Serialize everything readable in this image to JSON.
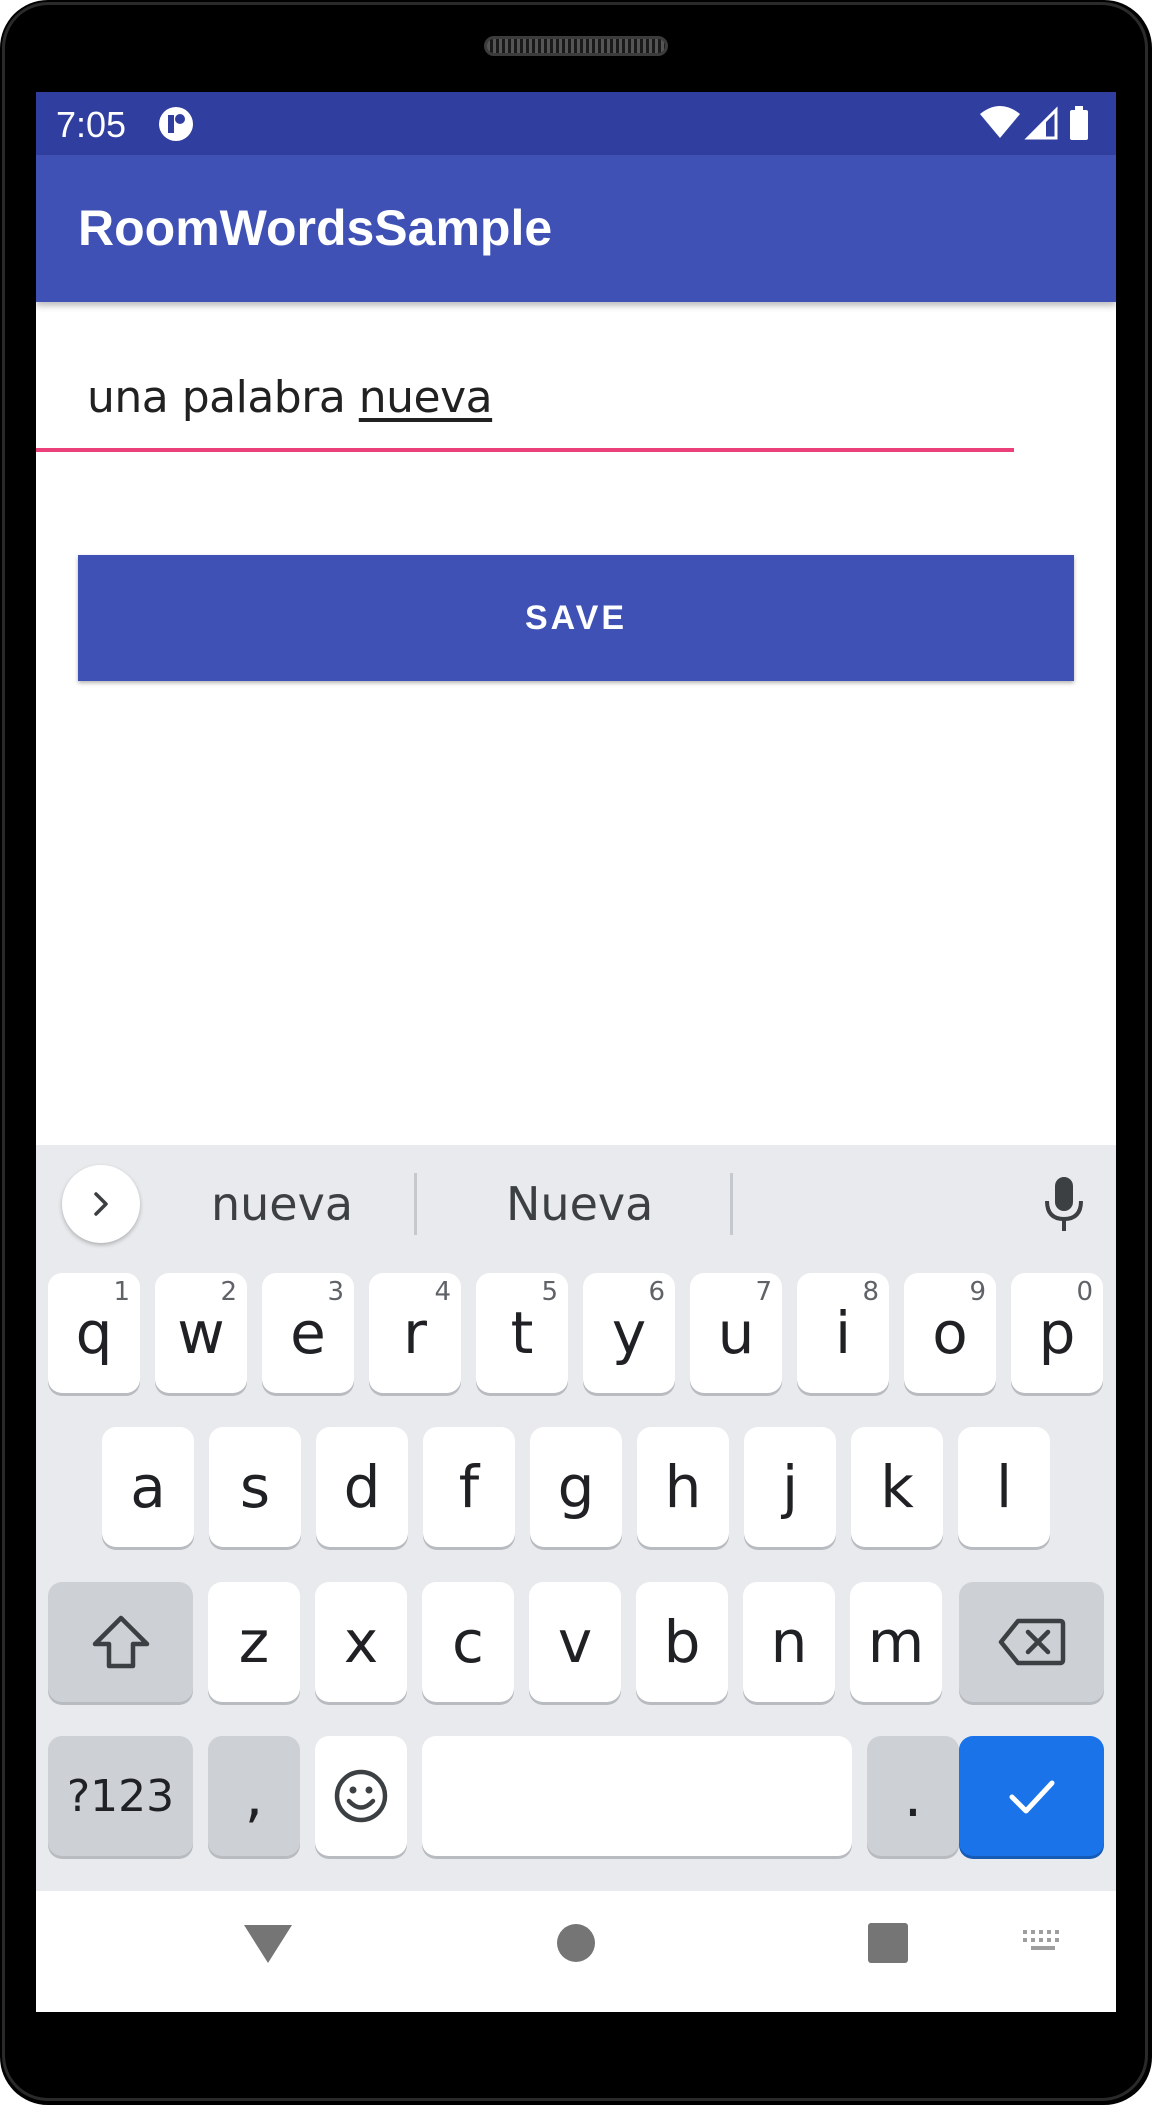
{
  "status_bar": {
    "time": "7:05"
  },
  "toolbar": {
    "title": "RoomWordsSample"
  },
  "edit": {
    "text_prefix": "una palabra ",
    "text_underlined": "nueva"
  },
  "save_button": {
    "label": "SAVE"
  },
  "keyboard": {
    "suggestions": [
      "nueva",
      "Nueva"
    ],
    "row1": [
      {
        "key": "q",
        "hint": "1"
      },
      {
        "key": "w",
        "hint": "2"
      },
      {
        "key": "e",
        "hint": "3"
      },
      {
        "key": "r",
        "hint": "4"
      },
      {
        "key": "t",
        "hint": "5"
      },
      {
        "key": "y",
        "hint": "6"
      },
      {
        "key": "u",
        "hint": "7"
      },
      {
        "key": "i",
        "hint": "8"
      },
      {
        "key": "o",
        "hint": "9"
      },
      {
        "key": "p",
        "hint": "0"
      }
    ],
    "row2": [
      "a",
      "s",
      "d",
      "f",
      "g",
      "h",
      "j",
      "k",
      "l"
    ],
    "row3": [
      "z",
      "x",
      "c",
      "v",
      "b",
      "n",
      "m"
    ],
    "symbols_label": "?123",
    "comma_label": ",",
    "period_label": "."
  },
  "colors": {
    "status_bar": "#303f9f",
    "toolbar": "#3f51b5",
    "accent": "#ec407a",
    "enter_key": "#1a73e8",
    "keyboard_bg": "#e8eaed"
  }
}
